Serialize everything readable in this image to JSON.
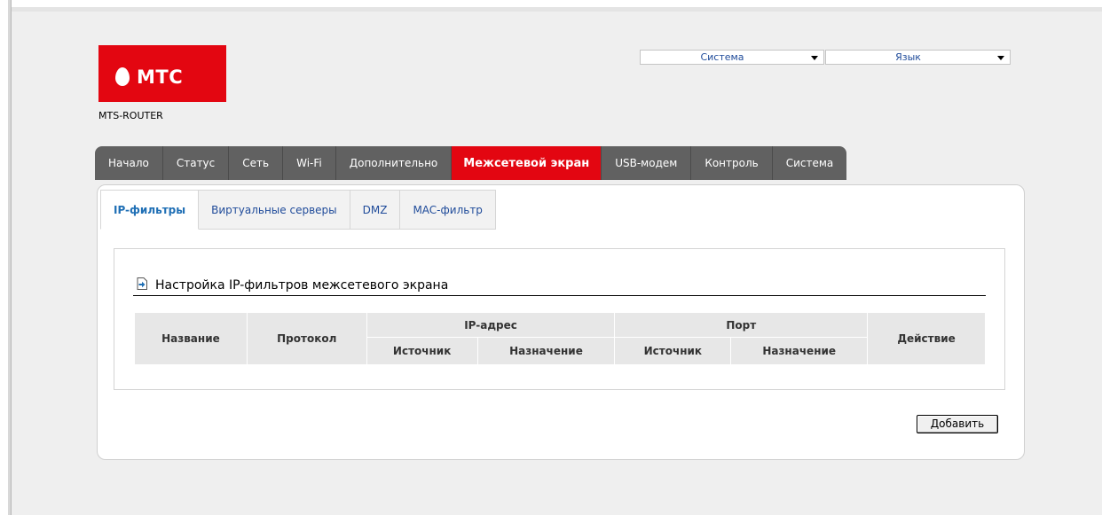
{
  "header": {
    "brand": "МТС",
    "router_name": "MTS-ROUTER",
    "system_select": "Система",
    "language_select": "Язык",
    "brand_color": "#e30611"
  },
  "main_nav": [
    {
      "label": "Начало",
      "active": false
    },
    {
      "label": "Статус",
      "active": false
    },
    {
      "label": "Сеть",
      "active": false
    },
    {
      "label": "Wi-Fi",
      "active": false
    },
    {
      "label": "Дополнительно",
      "active": false
    },
    {
      "label": "Межсетевой экран",
      "active": true
    },
    {
      "label": "USB-модем",
      "active": false
    },
    {
      "label": "Контроль",
      "active": false
    },
    {
      "label": "Система",
      "active": false
    }
  ],
  "sub_tabs": [
    {
      "label": "IP-фильтры",
      "active": true
    },
    {
      "label": "Виртуальные серверы",
      "active": false
    },
    {
      "label": "DMZ",
      "active": false
    },
    {
      "label": "MAC-фильтр",
      "active": false
    }
  ],
  "panel": {
    "title": "Настройка IP-фильтров межсетевого экрана",
    "icon": "arrow-doc-icon"
  },
  "table": {
    "headers": {
      "name": "Название",
      "protocol": "Протокол",
      "ip_address": "IP-адрес",
      "port": "Порт",
      "ip_source": "Источник",
      "ip_destination": "Назначение",
      "port_source": "Источник",
      "port_destination": "Назначение",
      "action": "Действие"
    },
    "rows": []
  },
  "buttons": {
    "add": "Добавить"
  }
}
